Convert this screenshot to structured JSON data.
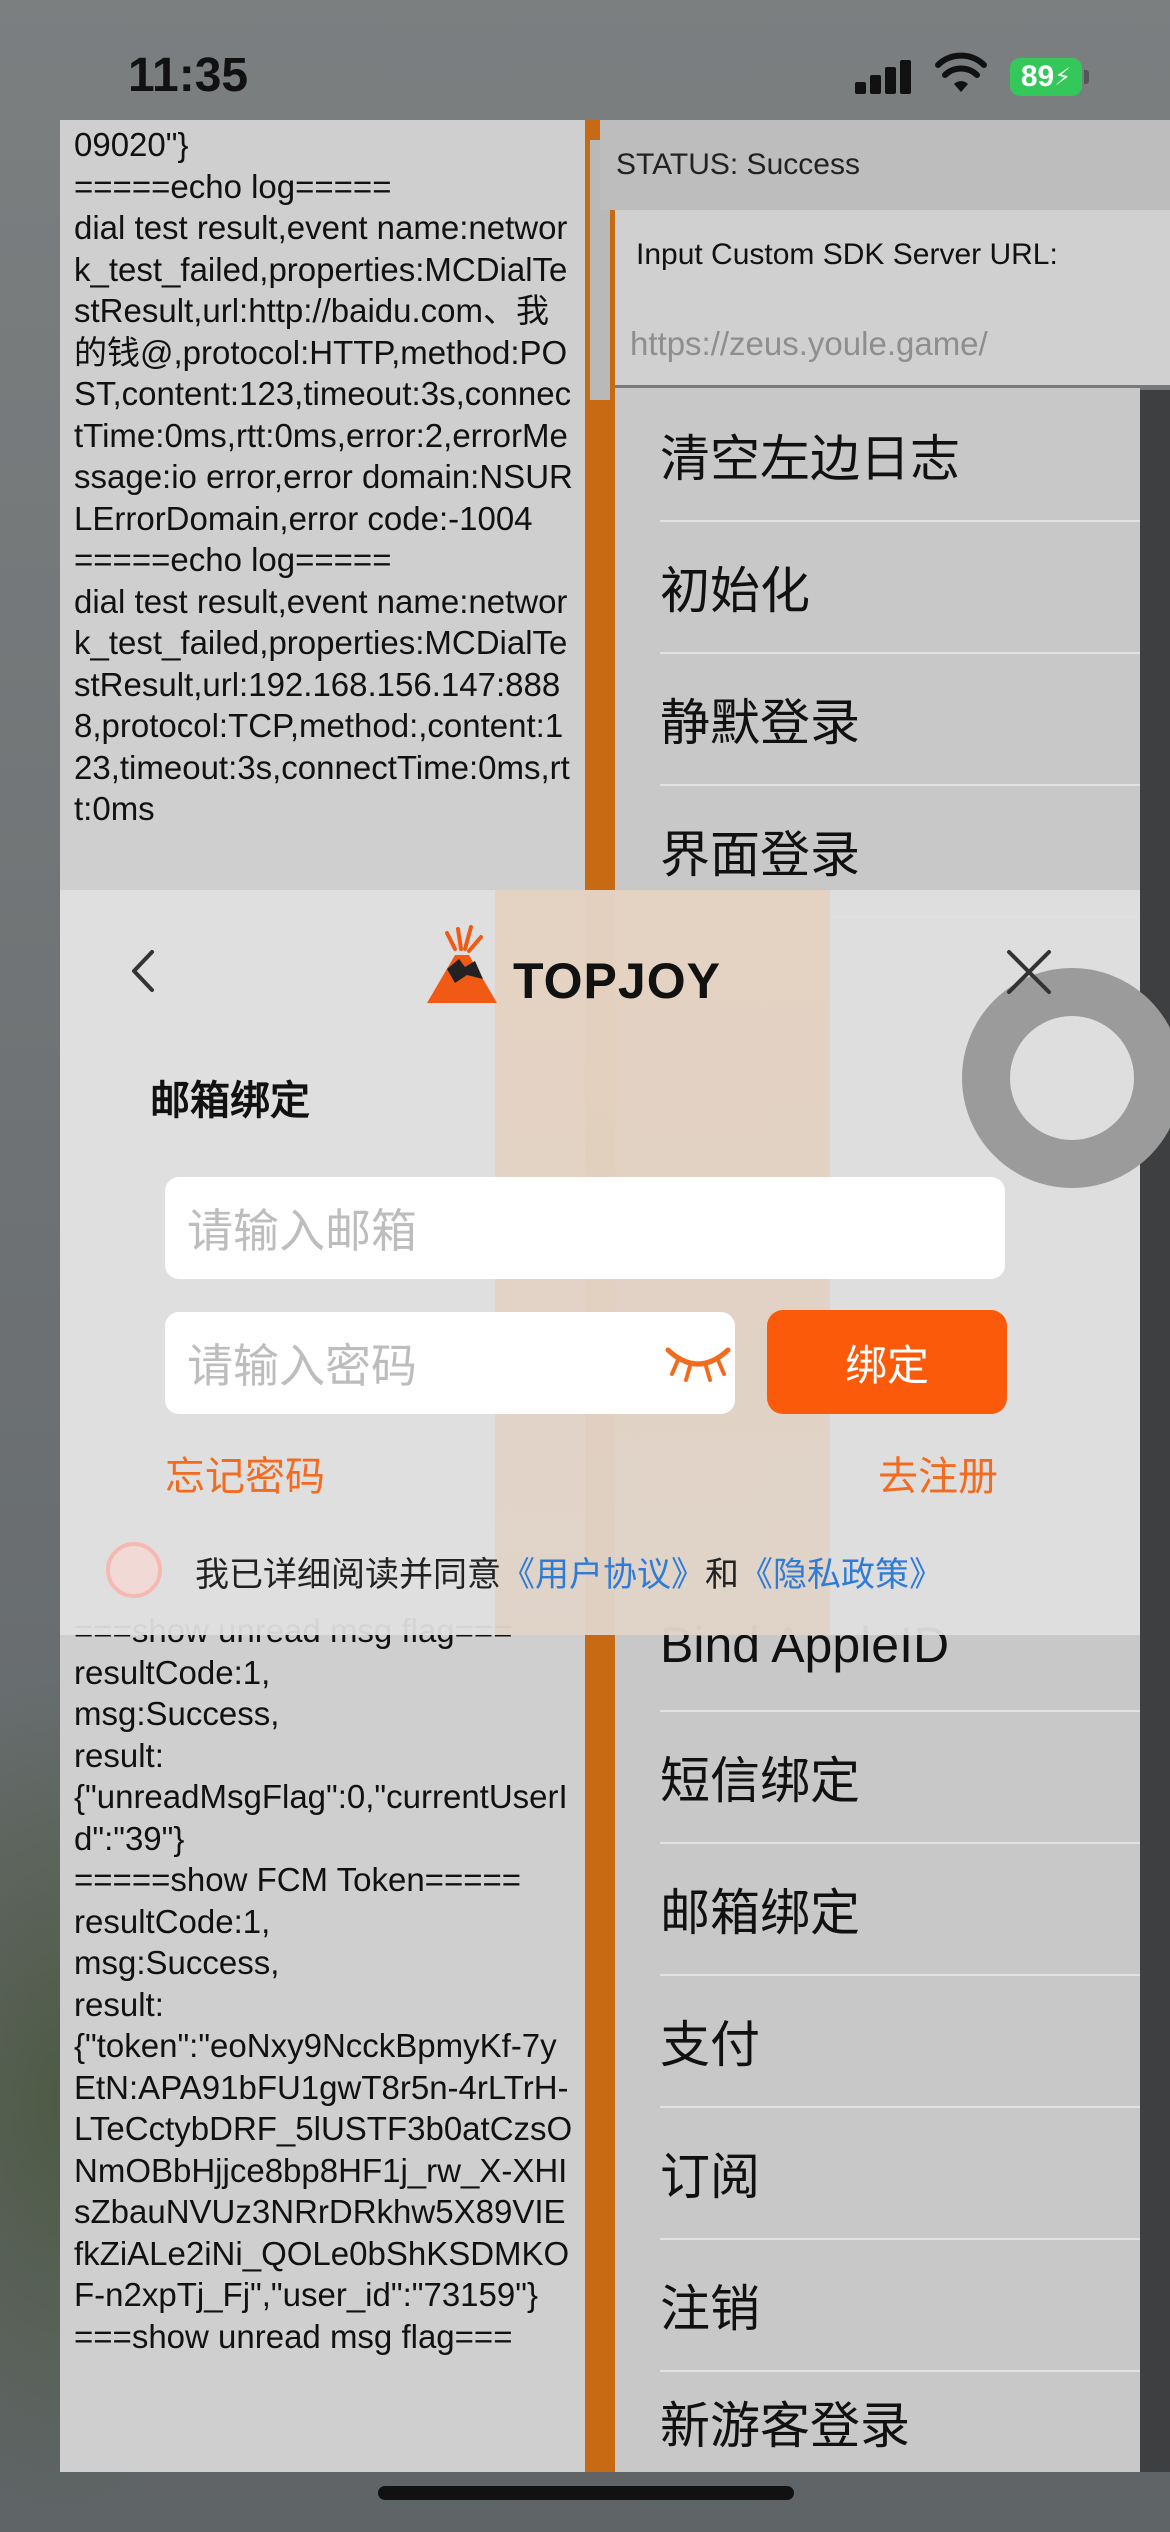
{
  "status_bar": {
    "time": "11:35",
    "battery": "89"
  },
  "log": {
    "top_text": "09020\"}\n=====echo log=====\ndial test result,event name:network_test_failed,properties:MCDialTestResult,url:http://baidu.com、我的钱@,protocol:HTTP,method:POST,content:123,timeout:3s,connectTime:0ms,rtt:0ms,error:2,errorMessage:io error,error domain:NSURLErrorDomain,error code:-1004\n=====echo log=====\ndial test result,event name:network_test_failed,properties:MCDialTestResult,url:192.168.156.147:8888,protocol:TCP,method:,content:123,timeout:3s,connectTime:0ms,rtt:0ms",
    "bottom_text": "===show unread msg flag===\nresultCode:1,\nmsg:Success,\nresult:\n{\"unreadMsgFlag\":0,\"currentUserId\":\"39\"}\n=====show FCM Token=====\nresultCode:1,\nmsg:Success,\nresult:\n{\"token\":\"eoNxy9NcckBpmyKf-7yEtN:APA91bFU1gwT8r5n-4rLTrH-LTeCctybDRF_5lUSTF3b0atCzsONmOBbHjjce8bp8HF1j_rw_X-XHIsZbauNVUz3NRrDRkhw5X89VIEfkZiALe2iNi_QOLe0bShKSDMKOF-n2xpTj_Fj\",\"user_id\":\"73159\"}\n===show unread msg flag==="
  },
  "right_panel": {
    "status": "STATUS: Success",
    "sdk_label": "Input Custom SDK Server URL:",
    "sdk_placeholder": "https://zeus.youle.game/",
    "menu_items": [
      "清空左边日志",
      "初始化",
      "静默登录",
      "界面登录",
      "Bind AppleID",
      "短信绑定",
      "邮箱绑定",
      "支付",
      "订阅",
      "注销",
      "新游客登录"
    ]
  },
  "dialog": {
    "logo_text": "TOPJOY",
    "title": "邮箱绑定",
    "email_placeholder": "请输入邮箱",
    "password_placeholder": "请输入密码",
    "bind_button": "绑定",
    "forgot_link": "忘记密码",
    "register_link": "去注册",
    "agree_prefix": "我已详细阅读并同意",
    "user_agreement": "《用户协议》",
    "and": "和",
    "privacy_policy": "《隐私政策》"
  },
  "colors": {
    "accent": "#fa5a0a",
    "link_orange": "#f26b1f",
    "link_blue": "#2f7bd6",
    "battery": "#34c759",
    "scroll_stripe": "#c86a14"
  },
  "icons": [
    "signal-icon",
    "wifi-icon",
    "back-icon",
    "close-icon",
    "volcano-logo-icon",
    "eye-closed-icon"
  ]
}
